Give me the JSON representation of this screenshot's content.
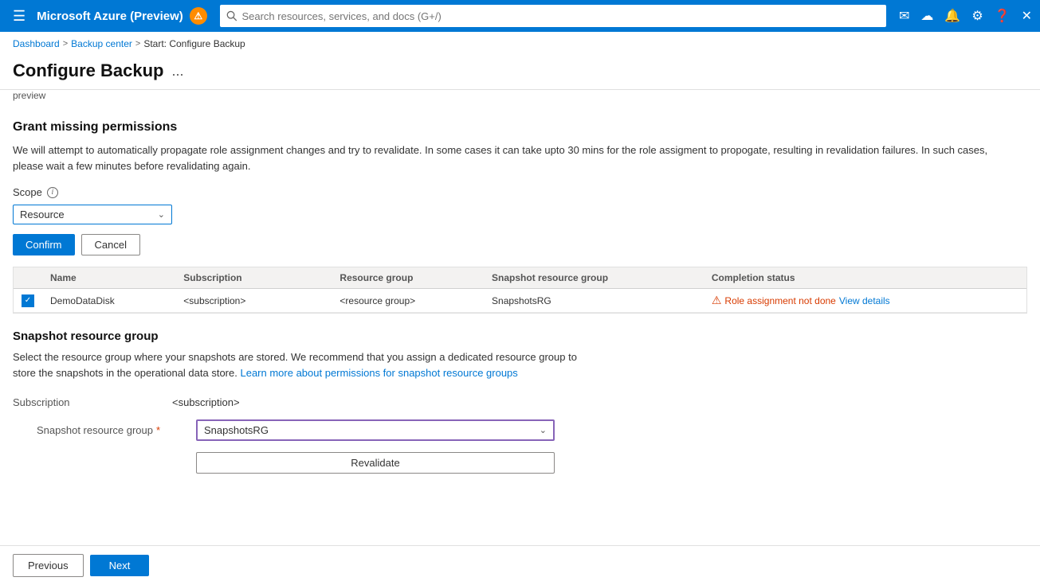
{
  "topnav": {
    "title": "Microsoft Azure (Preview)",
    "search_placeholder": "Search resources, services, and docs (G+/)",
    "notif_icon": "🔔",
    "alert_icon": "🔔"
  },
  "breadcrumb": {
    "items": [
      "Dashboard",
      "Backup center",
      "Start: Configure Backup"
    ]
  },
  "page": {
    "title": "Configure Backup",
    "ellipsis": "...",
    "preview_label": "preview"
  },
  "grant_permissions": {
    "section_title": "Grant missing permissions",
    "description": "We will attempt to automatically propagate role assignment changes and try to revalidate. In some cases it can take upto 30 mins for the role assigment to propogate, resulting in revalidation failures. In such cases, please wait a few minutes before revalidating again.",
    "scope_label": "Scope",
    "scope_value": "Resource",
    "confirm_btn": "Confirm",
    "cancel_btn": "Cancel"
  },
  "table": {
    "columns": [
      "Name",
      "Subscription",
      "",
      "Resource group",
      "Snapshot resource group",
      "Completion status"
    ],
    "rows": [
      {
        "checked": true,
        "name": "DemoDataDisk",
        "subscription": "<subscription>",
        "extra": "",
        "resource_group": "<resource group>",
        "snapshot_rg": "SnapshotsRG",
        "status": "Role assignment not done",
        "view_details": "View details"
      }
    ]
  },
  "snapshot_section": {
    "title": "Snapshot resource group",
    "description": "Select the resource group where your snapshots are stored. We recommend that you assign a dedicated resource group to store the snapshots in the operational data store.",
    "learn_more_text": "Learn more about permissions for snapshot resource groups",
    "learn_more_href": "#",
    "subscription_label": "Subscription",
    "subscription_value": "<subscription>",
    "snapshot_rg_label": "Snapshot resource group",
    "snapshot_rg_required": "*",
    "snapshot_rg_value": "SnapshotsRG",
    "revalidate_btn": "Revalidate"
  },
  "footer": {
    "previous_btn": "Previous",
    "next_btn": "Next"
  }
}
